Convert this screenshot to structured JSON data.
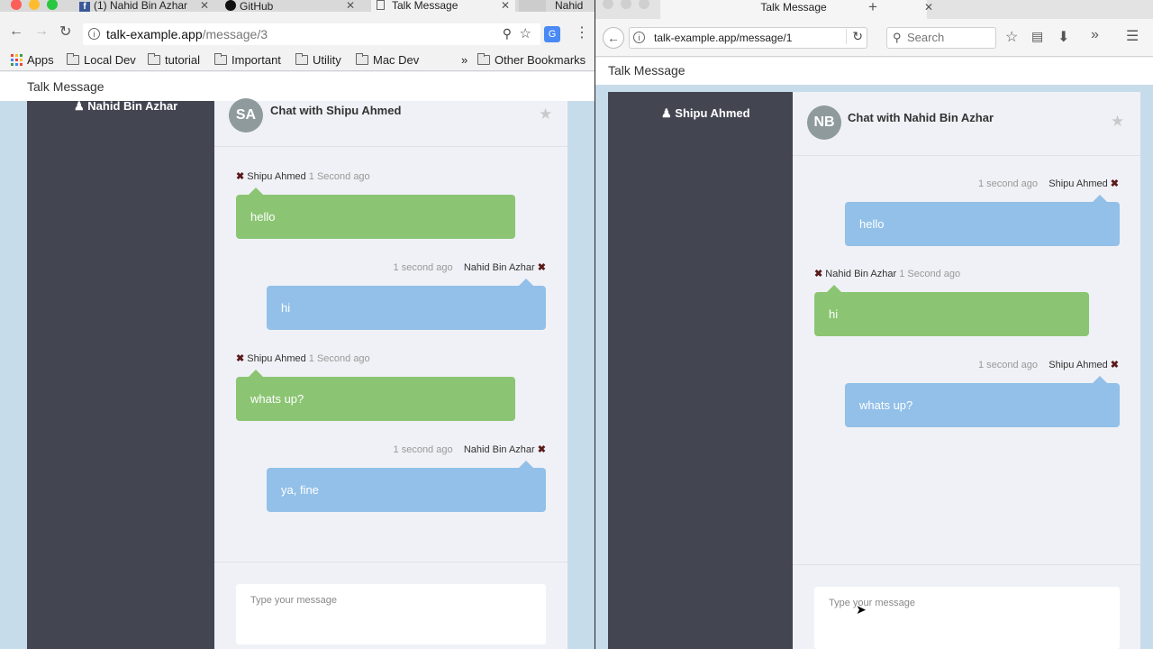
{
  "left_browser": {
    "tabs": [
      {
        "title": "(1) Nahid Bin Azhar",
        "icon": "facebook-icon"
      },
      {
        "title": "GitHub",
        "icon": "github-icon"
      },
      {
        "title": "Talk Message",
        "icon": "page-icon"
      },
      {
        "title": "Nahid",
        "icon": "profile"
      }
    ],
    "url_host": "talk-example.app",
    "url_path": "/message/3",
    "bookmarks": [
      "Apps",
      "Local Dev",
      "tutorial",
      "Important",
      "Utility",
      "Mac Dev"
    ],
    "bookmarks_overflow": "»",
    "other_bookmarks": "Other Bookmarks",
    "app": {
      "brand": "Talk Message",
      "sidebar_user": "Nahid Bin Azhar",
      "chat": {
        "avatar_initials": "SA",
        "title": "Chat with Shipu Ahmed",
        "messages": [
          {
            "side": "left",
            "sender": "Shipu Ahmed",
            "time": "1 Second ago",
            "text": "hello",
            "color": "green"
          },
          {
            "side": "right",
            "sender": "Nahid Bin Azhar",
            "time": "1 second ago",
            "text": "hi",
            "color": "blue"
          },
          {
            "side": "left",
            "sender": "Shipu Ahmed",
            "time": "1 Second ago",
            "text": "whats up?",
            "color": "green"
          },
          {
            "side": "right",
            "sender": "Nahid Bin Azhar",
            "time": "1 second ago",
            "text": "ya, fine",
            "color": "blue"
          }
        ],
        "compose_placeholder": "Type your message"
      }
    }
  },
  "right_browser": {
    "tab_title": "Talk Message",
    "new_tab": "+",
    "url": "talk-example.app/message/1",
    "search_placeholder": "Search",
    "overflow": "»",
    "app": {
      "brand": "Talk Message",
      "sidebar_user": "Shipu Ahmed",
      "chat": {
        "avatar_initials": "NB",
        "title": "Chat with Nahid Bin Azhar",
        "messages": [
          {
            "side": "right",
            "sender": "Shipu Ahmed",
            "time": "1 second ago",
            "text": "hello",
            "color": "blue"
          },
          {
            "side": "left",
            "sender": "Nahid Bin Azhar",
            "time": "1 Second ago",
            "text": "hi",
            "color": "green"
          },
          {
            "side": "right",
            "sender": "Shipu Ahmed",
            "time": "1 second ago",
            "text": "whats up?",
            "color": "blue"
          }
        ],
        "compose_placeholder": "Type your message"
      }
    }
  },
  "colors": {
    "sidebar": "#434651",
    "sent_bubble": "#8bc573",
    "received_bubble": "#92c0e8",
    "background": "#c7dceb",
    "delete_mark": "#5a1a1a"
  }
}
